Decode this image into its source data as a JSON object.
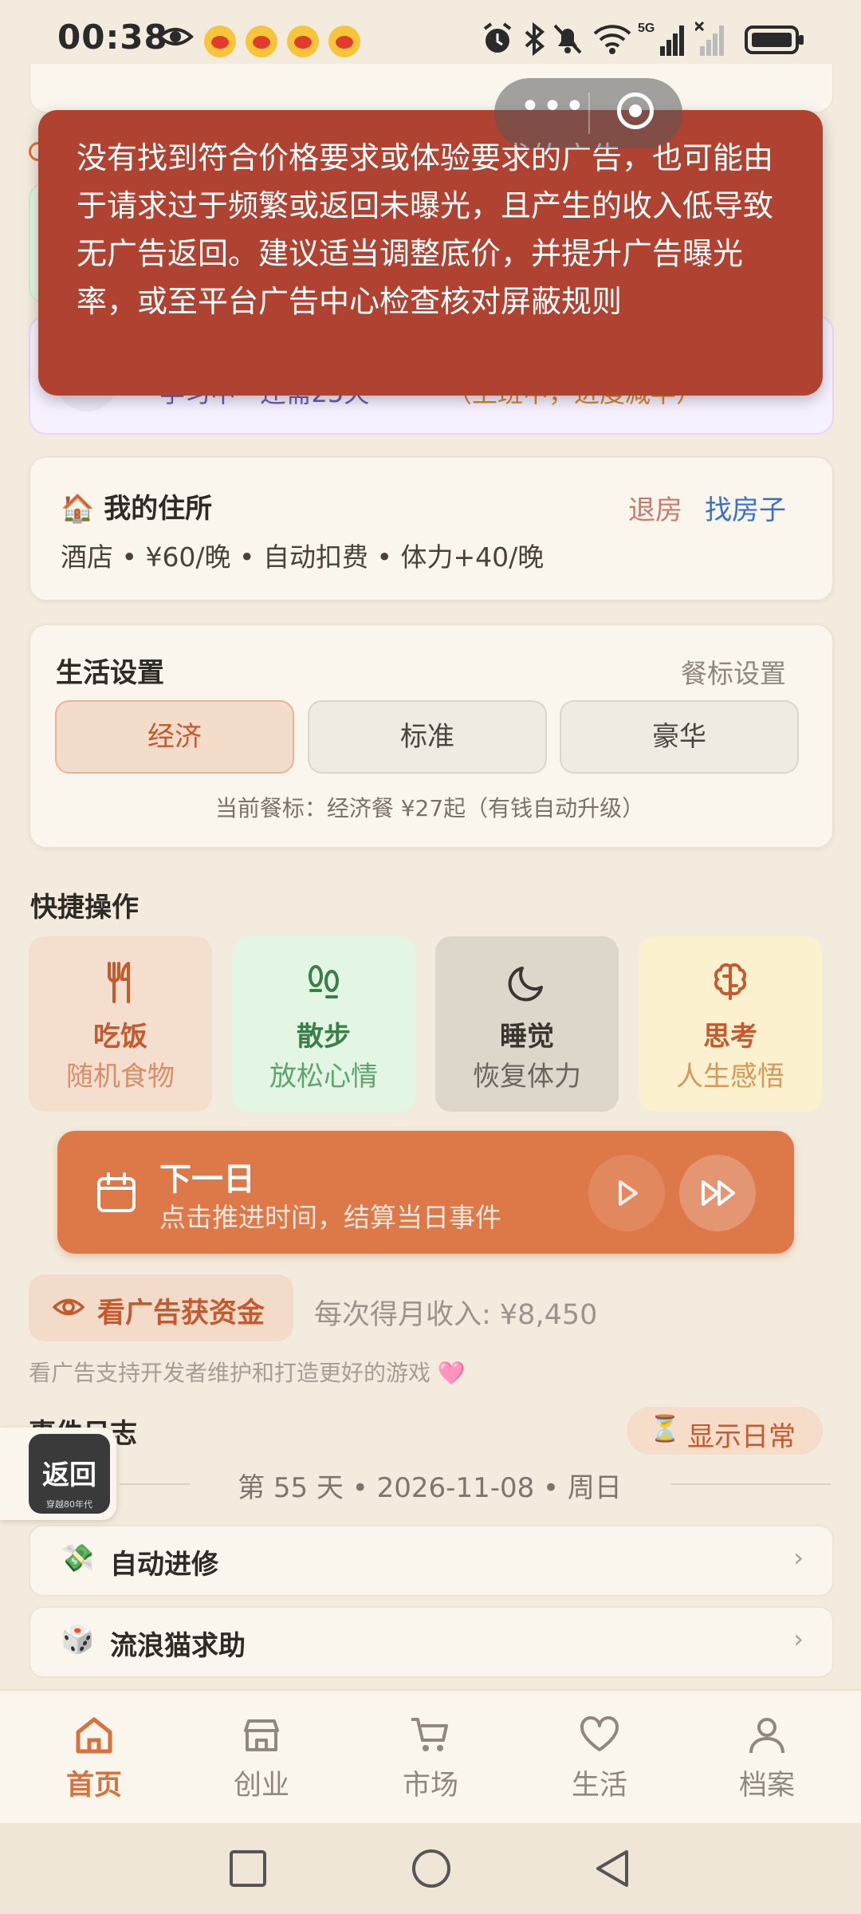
{
  "status_bar": {
    "time": "00:38",
    "network": "5G"
  },
  "toast": {
    "message": "没有找到符合价格要求或体验要求的广告，也可能由于请求过于频繁或返回未曝光，且产生的收入低导致无广告返回。建议适当调整底价，并提升广告曝光率，或至平台广告中心检查核对屏蔽规则"
  },
  "partial_card": {
    "status": "学习中 · 还需25天",
    "note": "（上班中，进度减半）"
  },
  "residence": {
    "icon": "🏠",
    "title": "我的住所",
    "checkout": "退房",
    "find_house": "找房子",
    "detail": "酒店 • ¥60/晚 • 自动扣费 • 体力+40/晚"
  },
  "life_settings": {
    "title": "生活设置",
    "meal_link": "餐标设置",
    "options": [
      "经济",
      "标准",
      "豪华"
    ],
    "selected": "经济",
    "current_note": "当前餐标：经济餐 ¥27起（有钱自动升级）"
  },
  "quick_actions": {
    "title": "快捷操作",
    "items": [
      {
        "label": "吃饭",
        "sub": "随机食物",
        "icon": "fork-knife-icon"
      },
      {
        "label": "散步",
        "sub": "放松心情",
        "icon": "footprints-icon"
      },
      {
        "label": "睡觉",
        "sub": "恢复体力",
        "icon": "moon-icon"
      },
      {
        "label": "思考",
        "sub": "人生感悟",
        "icon": "brain-icon"
      }
    ]
  },
  "next_day": {
    "title": "下一日",
    "subtitle": "点击推进时间，结算当日事件"
  },
  "ad": {
    "button": "看广告获资金",
    "income": "每次得月收入: ¥8,450",
    "note": "看广告支持开发者维护和打造更好的游戏 🩷"
  },
  "event_log": {
    "title": "事件日志",
    "show_daily": "显示日常",
    "show_daily_icon": "⏳",
    "day_header": "第 55 天 • 2026-11-08 • 周日",
    "events": [
      {
        "emoji": "💸",
        "label": "自动进修"
      },
      {
        "emoji": "🎲",
        "label": "流浪猫求助"
      }
    ]
  },
  "float_back": {
    "label": "返回",
    "sub": "穿越80年代"
  },
  "tabs": [
    {
      "label": "首页",
      "icon": "home-icon",
      "active": true
    },
    {
      "label": "创业",
      "icon": "store-icon",
      "active": false
    },
    {
      "label": "市场",
      "icon": "cart-icon",
      "active": false
    },
    {
      "label": "生活",
      "icon": "heart-icon",
      "active": false
    },
    {
      "label": "档案",
      "icon": "user-icon",
      "active": false
    }
  ],
  "colors": {
    "accent": "#D9713D",
    "toast_bg": "#B04232",
    "background": "#F3EBDD"
  }
}
